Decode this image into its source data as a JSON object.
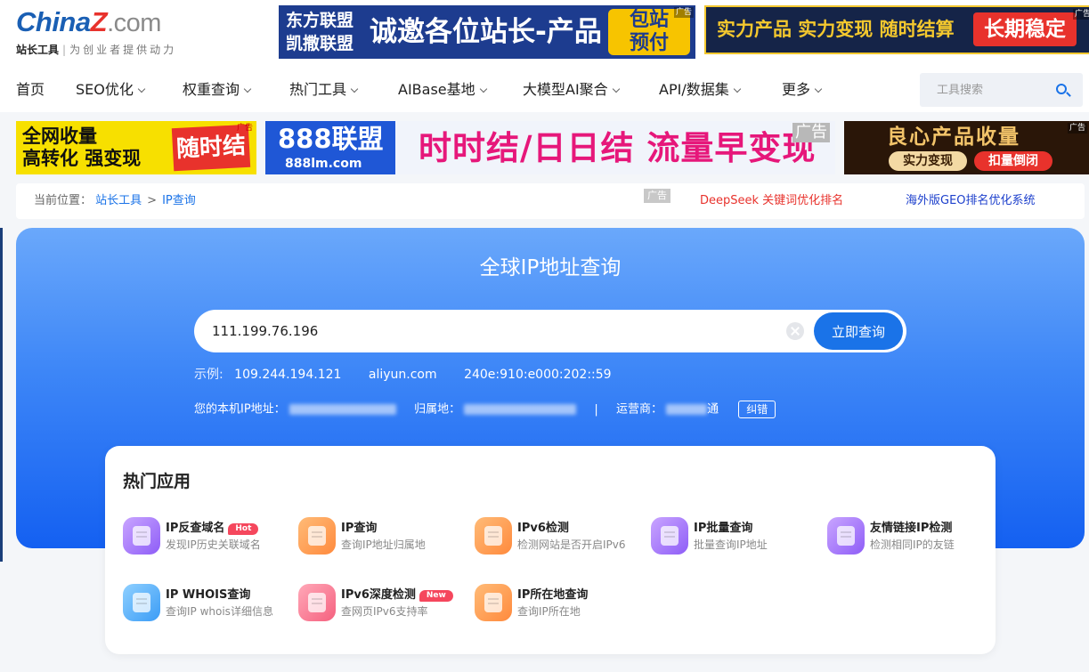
{
  "logo": {
    "name_a": "China",
    "name_z": "Z",
    "name_b": ".com",
    "sub_title": "站长工具",
    "slogan": "为创业者提供动力"
  },
  "ads": {
    "top1": {
      "line1": "东方联盟",
      "line2": "凯撒联盟",
      "headline": "诚邀各位站长-产品",
      "badge1": "包站",
      "badge2": "预付",
      "mark": "广告"
    },
    "top2": {
      "text": "实力产品 实力变现 随时结算",
      "button": "长期稳定",
      "mark": "广告"
    },
    "row2a": {
      "line1": "全网收量",
      "line2": "高转化 强变现",
      "badge": "随时结",
      "mark": "广告"
    },
    "row2b": {
      "logo_num": "888联盟",
      "logo_url": "888lm.com",
      "headline": "时时结/日日结  流量早变现",
      "mark": "广告"
    },
    "row2c": {
      "headline": "良心产品收量",
      "pill1": "实力变现",
      "pill2": "扣量倒闭",
      "mark": "广告"
    }
  },
  "nav": {
    "items": [
      {
        "label": "首页"
      },
      {
        "label": "SEO优化"
      },
      {
        "label": "权重查询"
      },
      {
        "label": "热门工具"
      },
      {
        "label": "AIBase基地"
      },
      {
        "label": "大模型AI聚合"
      },
      {
        "label": "API/数据集"
      },
      {
        "label": "更多"
      }
    ],
    "search_placeholder": "工具搜索"
  },
  "breadcrumb": {
    "prefix": "当前位置：",
    "home": "站长工具",
    "separator": ">",
    "current": "IP查询",
    "ad_mark": "广告",
    "link1": "DeepSeek 关键词优化排名",
    "link2": "海外版GEO排名优化系统"
  },
  "hero": {
    "title": "全球IP地址查询",
    "query_value": "111.199.76.196",
    "query_button": "立即查询",
    "examples_label": "示例:",
    "examples": [
      "109.244.194.121",
      "aliyun.com",
      "240e:910:e000:202::59"
    ],
    "local_ip_label": "您的本机IP地址：",
    "location_label": "归属地：",
    "pipe": "|",
    "isp_label": "运营商：",
    "isp_suffix": "通",
    "fix_button": "纠错"
  },
  "apps": {
    "title": "热门应用",
    "items": [
      {
        "name": "IP反查域名",
        "tag": "Hot",
        "desc": "发现IP历史关联域名",
        "color": "purple"
      },
      {
        "name": "IP查询",
        "tag": "",
        "desc": "查询IP地址归属地",
        "color": "orange"
      },
      {
        "name": "IPv6检测",
        "tag": "",
        "desc": "检测网站是否开启IPv6",
        "color": "orange"
      },
      {
        "name": "IP批量查询",
        "tag": "",
        "desc": "批量查询IP地址",
        "color": "purple"
      },
      {
        "name": "友情链接IP检测",
        "tag": "",
        "desc": "检测相同IP的友链",
        "color": "purple"
      },
      {
        "name": "IP WHOIS查询",
        "tag": "",
        "desc": "查询IP whois详细信息",
        "color": "blue"
      },
      {
        "name": "IPv6深度检测",
        "tag": "New",
        "desc": "查网页IPv6支持率",
        "color": "pink"
      },
      {
        "name": "IP所在地查询",
        "tag": "",
        "desc": "查询IP所在地",
        "color": "orange"
      }
    ]
  },
  "colors": {
    "accent": "#1a73e8",
    "hero_top": "#6aa8fb",
    "hero_bottom": "#1460f1",
    "hot_tag": "#f5475d"
  }
}
